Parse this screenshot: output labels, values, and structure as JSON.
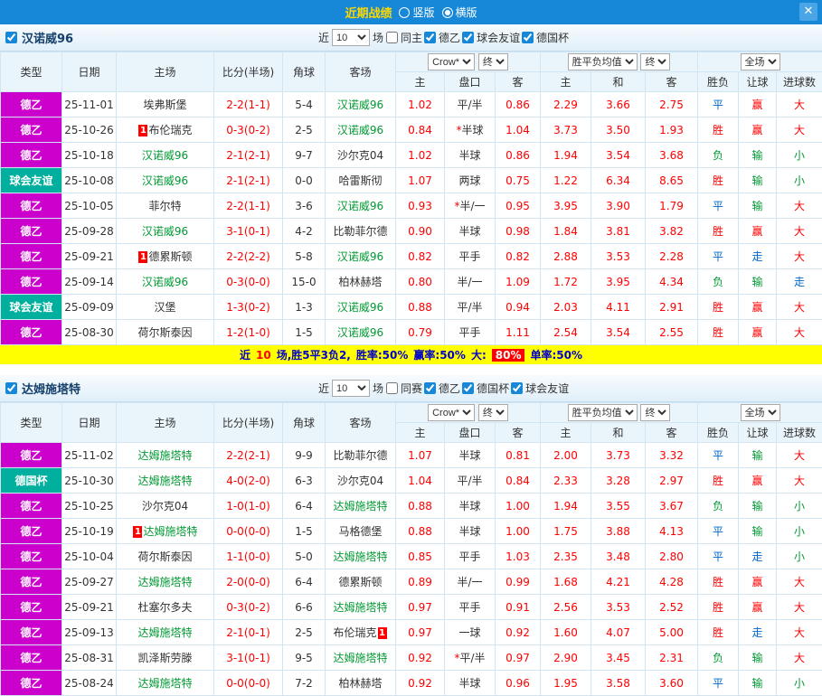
{
  "colors": {
    "magenta": "#cc00cc",
    "teal": "#00af9d",
    "focus_team": "#009933",
    "odds_red": "#ff0000",
    "result_blue": "#0066cc",
    "result_green": "#009933",
    "topbar_blue": "#1787d8",
    "summary_yellow": "#ffff00"
  },
  "topbar": {
    "title": "近期战绩",
    "vertical_label": "竖版",
    "horizontal_label": "横版",
    "selected_layout": "横版",
    "close_label": "✕"
  },
  "table_header": {
    "cols": [
      "类型",
      "日期",
      "主场",
      "比分(半场)",
      "角球",
      "客场"
    ],
    "sub_cols": [
      "主",
      "盘口",
      "客",
      "主",
      "和",
      "客",
      "胜负",
      "让球",
      "进球数"
    ],
    "odds_source": "Crow*",
    "final_label": "终",
    "europe_select": "胜平负均值",
    "scope_select": "全场"
  },
  "sections": [
    {
      "team": "汉诺威96",
      "team_checked": true,
      "filters": {
        "near_label": "近",
        "count": "10",
        "unit_label": "场",
        "checkboxes": [
          {
            "label": "同主",
            "checked": false
          },
          {
            "label": "德乙",
            "checked": true
          },
          {
            "label": "球会友谊",
            "checked": true
          },
          {
            "label": "德国杯",
            "checked": true
          }
        ]
      },
      "rows": [
        {
          "type": "德乙",
          "type_color": "magenta",
          "date": "25-11-01",
          "home": "埃弗斯堡",
          "home_focus": false,
          "home_card": "",
          "score": "2-2(1-1)",
          "corners": "5-4",
          "away": "汉诺威96",
          "away_focus": true,
          "away_card": "",
          "asian": [
            "1.02",
            "平/半",
            "0.86"
          ],
          "euro": [
            "2.29",
            "3.66",
            "2.75"
          ],
          "results": [
            [
              "平",
              "blue"
            ],
            [
              "赢",
              "red"
            ],
            [
              "大",
              "red"
            ]
          ]
        },
        {
          "type": "德乙",
          "type_color": "magenta",
          "date": "25-10-26",
          "home": "布伦瑞克",
          "home_focus": false,
          "home_card": "1",
          "score": "0-3(0-2)",
          "corners": "2-5",
          "away": "汉诺威96",
          "away_focus": true,
          "away_card": "",
          "asian": [
            "0.84",
            "*半球",
            "1.04"
          ],
          "euro": [
            "3.73",
            "3.50",
            "1.93"
          ],
          "results": [
            [
              "胜",
              "red"
            ],
            [
              "赢",
              "red"
            ],
            [
              "大",
              "red"
            ]
          ]
        },
        {
          "type": "德乙",
          "type_color": "magenta",
          "date": "25-10-18",
          "home": "汉诺威96",
          "home_focus": true,
          "home_card": "",
          "score": "2-1(2-1)",
          "corners": "9-7",
          "away": "沙尔克04",
          "away_focus": false,
          "away_card": "",
          "asian": [
            "1.02",
            "半球",
            "0.86"
          ],
          "euro": [
            "1.94",
            "3.54",
            "3.68"
          ],
          "results": [
            [
              "负",
              "green"
            ],
            [
              "输",
              "green"
            ],
            [
              "小",
              "green"
            ]
          ]
        },
        {
          "type": "球会友谊",
          "type_color": "teal",
          "date": "25-10-08",
          "home": "汉诺威96",
          "home_focus": true,
          "home_card": "",
          "score": "2-1(2-1)",
          "corners": "0-0",
          "away": "哈雷斯彻",
          "away_focus": false,
          "away_card": "",
          "asian": [
            "1.07",
            "两球",
            "0.75"
          ],
          "euro": [
            "1.22",
            "6.34",
            "8.65"
          ],
          "results": [
            [
              "胜",
              "red"
            ],
            [
              "输",
              "green"
            ],
            [
              "小",
              "green"
            ]
          ]
        },
        {
          "type": "德乙",
          "type_color": "magenta",
          "date": "25-10-05",
          "home": "菲尔特",
          "home_focus": false,
          "home_card": "",
          "score": "2-2(1-1)",
          "corners": "3-6",
          "away": "汉诺威96",
          "away_focus": true,
          "away_card": "",
          "asian": [
            "0.93",
            "*半/一",
            "0.95"
          ],
          "euro": [
            "3.95",
            "3.90",
            "1.79"
          ],
          "results": [
            [
              "平",
              "blue"
            ],
            [
              "输",
              "green"
            ],
            [
              "大",
              "red"
            ]
          ]
        },
        {
          "type": "德乙",
          "type_color": "magenta",
          "date": "25-09-28",
          "home": "汉诺威96",
          "home_focus": true,
          "home_card": "",
          "score": "3-1(0-1)",
          "corners": "4-2",
          "away": "比勒菲尔德",
          "away_focus": false,
          "away_card": "",
          "asian": [
            "0.90",
            "半球",
            "0.98"
          ],
          "euro": [
            "1.84",
            "3.81",
            "3.82"
          ],
          "results": [
            [
              "胜",
              "red"
            ],
            [
              "赢",
              "red"
            ],
            [
              "大",
              "red"
            ]
          ]
        },
        {
          "type": "德乙",
          "type_color": "magenta",
          "date": "25-09-21",
          "home": "德累斯顿",
          "home_focus": false,
          "home_card": "1",
          "score": "2-2(2-2)",
          "corners": "5-8",
          "away": "汉诺威96",
          "away_focus": true,
          "away_card": "",
          "asian": [
            "0.82",
            "平手",
            "0.82"
          ],
          "euro": [
            "2.88",
            "3.53",
            "2.28"
          ],
          "results": [
            [
              "平",
              "blue"
            ],
            [
              "走",
              "blue"
            ],
            [
              "大",
              "red"
            ]
          ]
        },
        {
          "type": "德乙",
          "type_color": "magenta",
          "date": "25-09-14",
          "home": "汉诺威96",
          "home_focus": true,
          "home_card": "",
          "score": "0-3(0-0)",
          "corners": "15-0",
          "away": "柏林赫塔",
          "away_focus": false,
          "away_card": "",
          "asian": [
            "0.80",
            "半/一",
            "1.09"
          ],
          "euro": [
            "1.72",
            "3.95",
            "4.34"
          ],
          "results": [
            [
              "负",
              "green"
            ],
            [
              "输",
              "green"
            ],
            [
              "走",
              "blue"
            ]
          ]
        },
        {
          "type": "球会友谊",
          "type_color": "teal",
          "date": "25-09-09",
          "home": "汉堡",
          "home_focus": false,
          "home_card": "",
          "score": "1-3(0-2)",
          "corners": "1-3",
          "away": "汉诺威96",
          "away_focus": true,
          "away_card": "",
          "asian": [
            "0.88",
            "平/半",
            "0.94"
          ],
          "euro": [
            "2.03",
            "4.11",
            "2.91"
          ],
          "results": [
            [
              "胜",
              "red"
            ],
            [
              "赢",
              "red"
            ],
            [
              "大",
              "red"
            ]
          ]
        },
        {
          "type": "德乙",
          "type_color": "magenta",
          "date": "25-08-30",
          "home": "荷尔斯泰因",
          "home_focus": false,
          "home_card": "",
          "score": "1-2(1-0)",
          "corners": "1-5",
          "away": "汉诺威96",
          "away_focus": true,
          "away_card": "",
          "asian": [
            "0.79",
            "平手",
            "1.11"
          ],
          "euro": [
            "2.54",
            "3.54",
            "2.55"
          ],
          "results": [
            [
              "胜",
              "red"
            ],
            [
              "赢",
              "red"
            ],
            [
              "大",
              "red"
            ]
          ]
        }
      ],
      "summary": [
        {
          "text": "近",
          "style": "blue"
        },
        {
          "text": "10",
          "style": "red"
        },
        {
          "text": "场,胜5平3负2,",
          "style": "blue"
        },
        {
          "text": "胜率:50%",
          "style": "blue"
        },
        {
          "text": "赢率:50%",
          "style": "blue"
        },
        {
          "text": "大:",
          "style": "blue"
        },
        {
          "text": "80%",
          "style": "highlight"
        },
        {
          "text": "单率:50%",
          "style": "blue"
        }
      ]
    },
    {
      "team": "达姆施塔特",
      "team_checked": true,
      "filters": {
        "near_label": "近",
        "count": "10",
        "unit_label": "场",
        "checkboxes": [
          {
            "label": "同赛",
            "checked": false
          },
          {
            "label": "德乙",
            "checked": true
          },
          {
            "label": "德国杯",
            "checked": true
          },
          {
            "label": "球会友谊",
            "checked": true
          }
        ]
      },
      "rows": [
        {
          "type": "德乙",
          "type_color": "magenta",
          "date": "25-11-02",
          "home": "达姆施塔特",
          "home_focus": true,
          "home_card": "",
          "score": "2-2(2-1)",
          "corners": "9-9",
          "away": "比勒菲尔德",
          "away_focus": false,
          "away_card": "",
          "asian": [
            "1.07",
            "半球",
            "0.81"
          ],
          "euro": [
            "2.00",
            "3.73",
            "3.32"
          ],
          "results": [
            [
              "平",
              "blue"
            ],
            [
              "输",
              "green"
            ],
            [
              "大",
              "red"
            ]
          ]
        },
        {
          "type": "德国杯",
          "type_color": "teal",
          "date": "25-10-30",
          "home": "达姆施塔特",
          "home_focus": true,
          "home_card": "",
          "score": "4-0(2-0)",
          "corners": "6-3",
          "away": "沙尔克04",
          "away_focus": false,
          "away_card": "",
          "asian": [
            "1.04",
            "平/半",
            "0.84"
          ],
          "euro": [
            "2.33",
            "3.28",
            "2.97"
          ],
          "results": [
            [
              "胜",
              "red"
            ],
            [
              "赢",
              "red"
            ],
            [
              "大",
              "red"
            ]
          ]
        },
        {
          "type": "德乙",
          "type_color": "magenta",
          "date": "25-10-25",
          "home": "沙尔克04",
          "home_focus": false,
          "home_card": "",
          "score": "1-0(1-0)",
          "corners": "6-4",
          "away": "达姆施塔特",
          "away_focus": true,
          "away_card": "",
          "asian": [
            "0.88",
            "半球",
            "1.00"
          ],
          "euro": [
            "1.94",
            "3.55",
            "3.67"
          ],
          "results": [
            [
              "负",
              "green"
            ],
            [
              "输",
              "green"
            ],
            [
              "小",
              "green"
            ]
          ]
        },
        {
          "type": "德乙",
          "type_color": "magenta",
          "date": "25-10-19",
          "home": "达姆施塔特",
          "home_focus": true,
          "home_card": "1",
          "score": "0-0(0-0)",
          "corners": "1-5",
          "away": "马格德堡",
          "away_focus": false,
          "away_card": "",
          "asian": [
            "0.88",
            "半球",
            "1.00"
          ],
          "euro": [
            "1.75",
            "3.88",
            "4.13"
          ],
          "results": [
            [
              "平",
              "blue"
            ],
            [
              "输",
              "green"
            ],
            [
              "小",
              "green"
            ]
          ]
        },
        {
          "type": "德乙",
          "type_color": "magenta",
          "date": "25-10-04",
          "home": "荷尔斯泰因",
          "home_focus": false,
          "home_card": "",
          "score": "1-1(0-0)",
          "corners": "5-0",
          "away": "达姆施塔特",
          "away_focus": true,
          "away_card": "",
          "asian": [
            "0.85",
            "平手",
            "1.03"
          ],
          "euro": [
            "2.35",
            "3.48",
            "2.80"
          ],
          "results": [
            [
              "平",
              "blue"
            ],
            [
              "走",
              "blue"
            ],
            [
              "小",
              "green"
            ]
          ]
        },
        {
          "type": "德乙",
          "type_color": "magenta",
          "date": "25-09-27",
          "home": "达姆施塔特",
          "home_focus": true,
          "home_card": "",
          "score": "2-0(0-0)",
          "corners": "6-4",
          "away": "德累斯顿",
          "away_focus": false,
          "away_card": "",
          "asian": [
            "0.89",
            "半/一",
            "0.99"
          ],
          "euro": [
            "1.68",
            "4.21",
            "4.28"
          ],
          "results": [
            [
              "胜",
              "red"
            ],
            [
              "赢",
              "red"
            ],
            [
              "大",
              "red"
            ]
          ]
        },
        {
          "type": "德乙",
          "type_color": "magenta",
          "date": "25-09-21",
          "home": "杜塞尔多夫",
          "home_focus": false,
          "home_card": "",
          "score": "0-3(0-2)",
          "corners": "6-6",
          "away": "达姆施塔特",
          "away_focus": true,
          "away_card": "",
          "asian": [
            "0.97",
            "平手",
            "0.91"
          ],
          "euro": [
            "2.56",
            "3.53",
            "2.52"
          ],
          "results": [
            [
              "胜",
              "red"
            ],
            [
              "赢",
              "red"
            ],
            [
              "大",
              "red"
            ]
          ]
        },
        {
          "type": "德乙",
          "type_color": "magenta",
          "date": "25-09-13",
          "home": "达姆施塔特",
          "home_focus": true,
          "home_card": "",
          "score": "2-1(0-1)",
          "corners": "2-5",
          "away": "布伦瑞克",
          "away_focus": false,
          "away_card": "1",
          "asian": [
            "0.97",
            "一球",
            "0.92"
          ],
          "euro": [
            "1.60",
            "4.07",
            "5.00"
          ],
          "results": [
            [
              "胜",
              "red"
            ],
            [
              "走",
              "blue"
            ],
            [
              "大",
              "red"
            ]
          ]
        },
        {
          "type": "德乙",
          "type_color": "magenta",
          "date": "25-08-31",
          "home": "凯泽斯劳滕",
          "home_focus": false,
          "home_card": "",
          "score": "3-1(0-1)",
          "corners": "9-5",
          "away": "达姆施塔特",
          "away_focus": true,
          "away_card": "",
          "asian": [
            "0.92",
            "*平/半",
            "0.97"
          ],
          "euro": [
            "2.90",
            "3.45",
            "2.31"
          ],
          "results": [
            [
              "负",
              "green"
            ],
            [
              "输",
              "green"
            ],
            [
              "大",
              "red"
            ]
          ]
        },
        {
          "type": "德乙",
          "type_color": "magenta",
          "date": "25-08-24",
          "home": "达姆施塔特",
          "home_focus": true,
          "home_card": "",
          "score": "0-0(0-0)",
          "corners": "7-2",
          "away": "柏林赫塔",
          "away_focus": false,
          "away_card": "",
          "asian": [
            "0.92",
            "半球",
            "0.96"
          ],
          "euro": [
            "1.95",
            "3.58",
            "3.60"
          ],
          "results": [
            [
              "平",
              "blue"
            ],
            [
              "输",
              "green"
            ],
            [
              "小",
              "green"
            ]
          ]
        }
      ],
      "summary": null
    }
  ]
}
